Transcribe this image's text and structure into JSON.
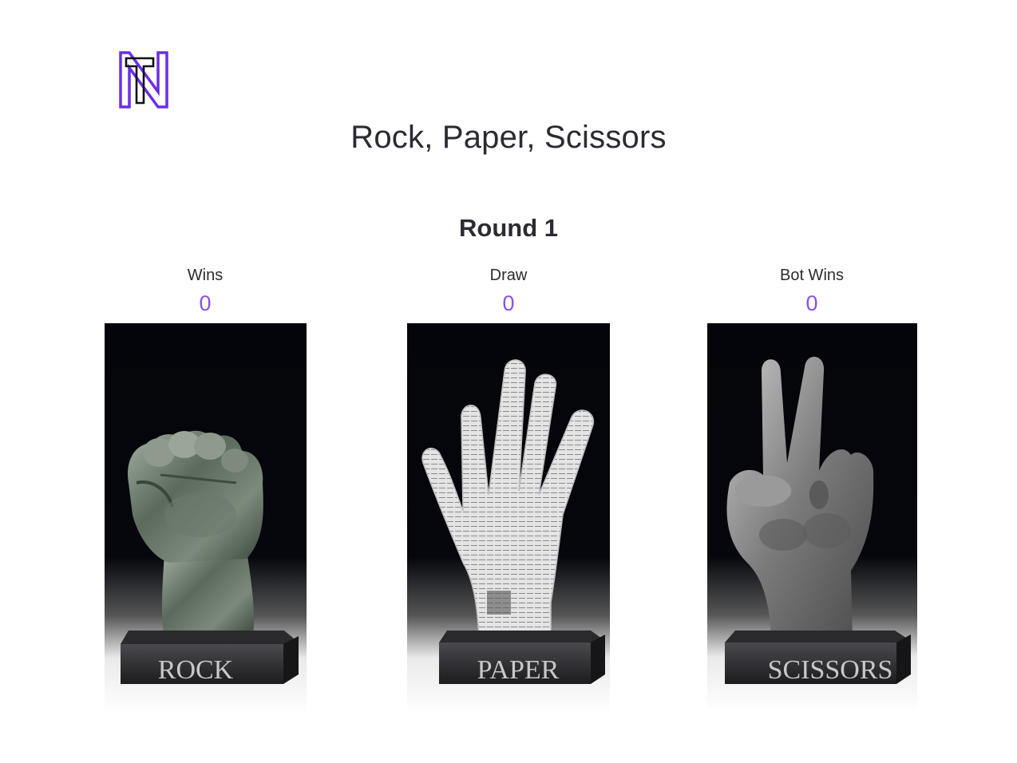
{
  "header": {
    "logo_icon": "nt-logo-icon",
    "title": "Rock, Paper, Scissors"
  },
  "round": {
    "label": "Round 1"
  },
  "scores": {
    "wins": {
      "label": "Wins",
      "value": "0"
    },
    "draw": {
      "label": "Draw",
      "value": "0"
    },
    "bot_wins": {
      "label": "Bot Wins",
      "value": "0"
    }
  },
  "choices": [
    {
      "label": "ROCK",
      "icon": "fist-statue-icon"
    },
    {
      "label": "PAPER",
      "icon": "open-hand-statue-icon"
    },
    {
      "label": "SCISSORS",
      "icon": "peace-sign-statue-icon"
    }
  ],
  "colors": {
    "accent": "#8a50e8",
    "logo_outline": "#6a2ee8",
    "text": "#2a2b33"
  }
}
